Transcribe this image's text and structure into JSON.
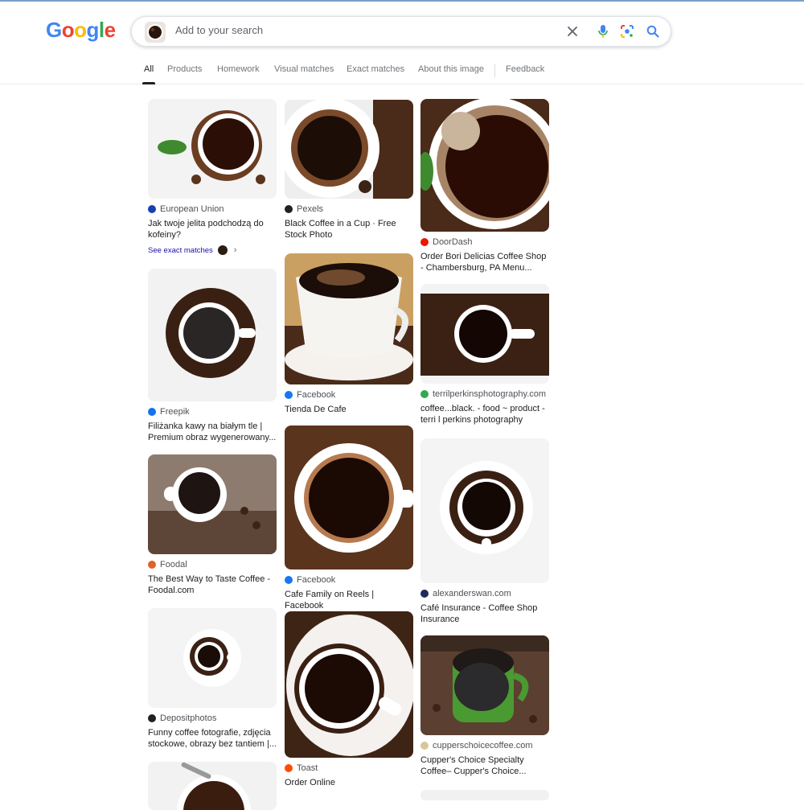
{
  "logo": {
    "g1": "G",
    "o1": "o",
    "o2": "o",
    "g2": "g",
    "l": "l",
    "e": "e"
  },
  "search": {
    "placeholder": "Add to your search"
  },
  "tabs": [
    {
      "label": "All"
    },
    {
      "label": "Products"
    },
    {
      "label": "Homework"
    },
    {
      "label": "Visual matches"
    },
    {
      "label": "Exact matches"
    },
    {
      "label": "About this image"
    },
    {
      "label": "Feedback"
    }
  ],
  "exact_matches_label": "See exact matches",
  "results": [
    {
      "source": "European Union",
      "title": "Jak twoje jelita podchodzą do kofeiny?",
      "fav_color": "#1a3fb0"
    },
    {
      "source": "Pexels",
      "title": "Black Coffee in a Cup · Free Stock Photo",
      "fav_color": "#202124"
    },
    {
      "source": "DoorDash",
      "title": "Order Bori Delicias Coffee Shop - Chambersburg, PA Menu...",
      "fav_color": "#eb1700"
    },
    {
      "source": "Freepik",
      "title": "Filiżanka kawy na białym tle | Premium obraz wygenerowany...",
      "fav_color": "#1273eb"
    },
    {
      "source": "Facebook",
      "title": "Tienda De Cafe",
      "fav_color": "#1877f2"
    },
    {
      "source": "terrilperkinsphotography.com",
      "title": "coffee...black. - food ~ product - terri l perkins photography",
      "fav_color": "#34a853"
    },
    {
      "source": "Foodal",
      "title": "The Best Way to Taste Coffee - Foodal.com",
      "fav_color": "#e0632a"
    },
    {
      "source": "Facebook",
      "title": "Cafe Family on Reels | Facebook",
      "fav_color": "#1877f2"
    },
    {
      "source": "alexanderswan.com",
      "title": "Café Insurance - Coffee Shop Insurance",
      "fav_color": "#1f2a5a"
    },
    {
      "source": "Depositphotos",
      "title": "Funny coffee fotografie, zdjęcia stockowe, obrazy bez tantiem |...",
      "fav_color": "#202124"
    },
    {
      "source": "Toast",
      "title": "Order Online",
      "fav_color": "#ff4c00"
    },
    {
      "source": "cupperschoicecoffee.com",
      "title": "Cupper's Choice Specialty Coffee– Cupper's Choice...",
      "fav_color": "#d9c79a"
    }
  ]
}
